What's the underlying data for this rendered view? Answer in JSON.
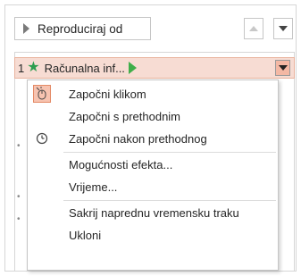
{
  "toolbar": {
    "play_from": "Reproduciraj od"
  },
  "animation": {
    "number": "1",
    "name": "Računalna inf..."
  },
  "hints": [
    "•",
    "•",
    "•"
  ],
  "menu": {
    "items": [
      {
        "label": "Započni klikom"
      },
      {
        "label": "Započni s prethodnim"
      },
      {
        "label": "Započni nakon prethodnog"
      },
      {
        "label": "Mogućnosti efekta..."
      },
      {
        "label": "Vrijeme..."
      },
      {
        "label": "Sakrij naprednu vremensku traku"
      },
      {
        "label": "Ukloni"
      }
    ]
  },
  "colors": {
    "selected_row": "#f7dcd3",
    "accent": "#e48a66",
    "star": "#2e9e4f",
    "play_green": "#3fae49"
  }
}
